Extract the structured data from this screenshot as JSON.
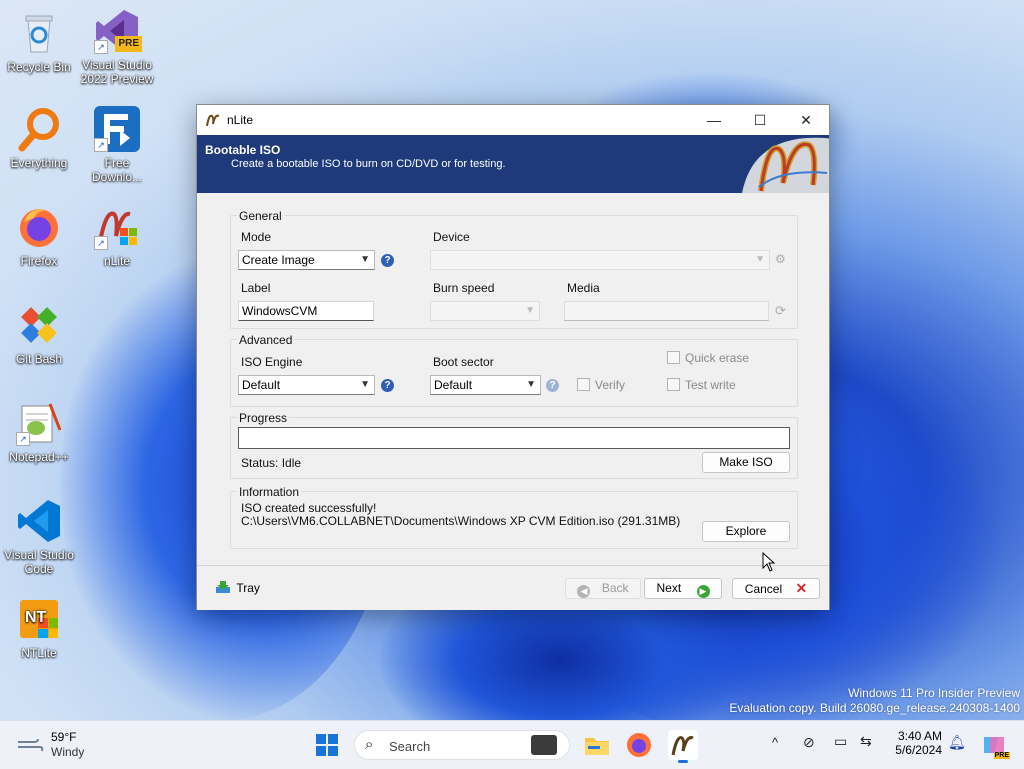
{
  "desktop": {
    "icons": [
      {
        "label": "Recycle Bin"
      },
      {
        "label": "Visual Studio 2022 Preview",
        "badge": "PRE"
      },
      {
        "label": "Everything"
      },
      {
        "label": "Free Downlo..."
      },
      {
        "label": "Firefox"
      },
      {
        "label": "nLite"
      },
      {
        "label": "Git Bash"
      },
      {
        "label": "Notepad++"
      },
      {
        "label": "Visual Studio Code"
      },
      {
        "label": "NTLite"
      }
    ],
    "watermark": {
      "line1": "Windows 11 Pro Insider Preview",
      "line2": "Evaluation copy. Build 26080.ge_release.240308-1400"
    }
  },
  "window": {
    "title": "nLite",
    "controls": {
      "minimize": "—",
      "maximize": "☐",
      "close": "✕"
    },
    "banner": {
      "heading": "Bootable ISO",
      "subtitle": "Create a bootable ISO to burn on CD/DVD or for testing."
    },
    "general": {
      "group_label": "General",
      "mode_label": "Mode",
      "mode_value": "Create Image",
      "device_label": "Device",
      "device_value": "",
      "label_label": "Label",
      "label_value": "WindowsCVM",
      "burn_speed_label": "Burn speed",
      "burn_speed_value": "",
      "media_label": "Media",
      "media_value": ""
    },
    "advanced": {
      "group_label": "Advanced",
      "iso_engine_label": "ISO Engine",
      "iso_engine_value": "Default",
      "boot_sector_label": "Boot sector",
      "boot_sector_value": "Default",
      "verify_label": "Verify",
      "quick_erase_label": "Quick erase",
      "test_write_label": "Test write"
    },
    "progress": {
      "group_label": "Progress",
      "value_percent": 0,
      "status": "Status: Idle",
      "make_iso_label": "Make ISO"
    },
    "information": {
      "group_label": "Information",
      "line1": "ISO created successfully!",
      "line2": "C:\\Users\\VM6.COLLABNET\\Documents\\Windows XP CVM Edition.iso (291.31MB)",
      "explore_label": "Explore"
    },
    "footer": {
      "tray_label": "Tray",
      "back_label": "Back",
      "next_label": "Next",
      "cancel_label": "Cancel"
    }
  },
  "taskbar": {
    "weather_temp": "59°F",
    "weather_desc": "Windy",
    "search_placeholder": "Search",
    "time": "3:40 AM",
    "date": "5/6/2024",
    "copilot_badge": "PRE"
  },
  "colors": {
    "banner": "#1e3a7a",
    "help_icon": "#2d5fb5",
    "next_green": "#3aa535",
    "cancel_red": "#d42a2a"
  }
}
